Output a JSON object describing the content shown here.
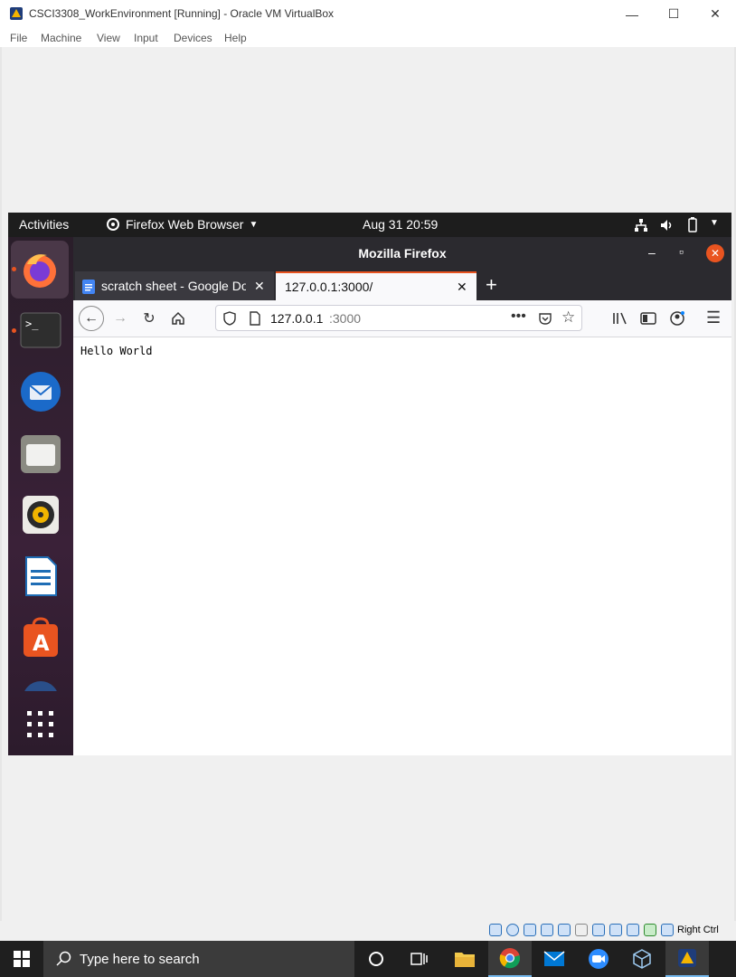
{
  "vbox": {
    "title": "CSCI3308_WorkEnvironment [Running] - Oracle VM VirtualBox",
    "menu": [
      "File",
      "Machine",
      "View",
      "Input",
      "Devices",
      "Help"
    ],
    "window_controls": {
      "minimize": "—",
      "maximize": "☐",
      "close": "✕"
    },
    "host_key": "Right Ctrl"
  },
  "gnome": {
    "activities": "Activities",
    "app_menu": "Firefox Web Browser",
    "clock": "Aug 31  20:59"
  },
  "firefox": {
    "window_title": "Mozilla Firefox",
    "tabs": [
      {
        "label": "scratch sheet - Google Do"
      },
      {
        "label": "127.0.0.1:3000/"
      }
    ],
    "new_tab": "+",
    "url_host": "127.0.0.1",
    "url_port": ":3000",
    "page_text": "Hello World",
    "controls": {
      "minimize": "–",
      "restore": "▫",
      "close": "✕"
    }
  },
  "dock": {
    "apps": [
      "firefox-icon",
      "terminal-icon",
      "thunderbird-icon",
      "files-icon",
      "rhythmbox-icon",
      "writer-icon",
      "software-icon",
      "help-icon"
    ],
    "show_apps": "show-applications-icon"
  },
  "taskbar": {
    "search_placeholder": "Type here to search"
  },
  "colors": {
    "ubuntu_orange": "#e95420",
    "firefox_dark": "#2b2a2f",
    "taskbar": "#1f1f1f"
  }
}
